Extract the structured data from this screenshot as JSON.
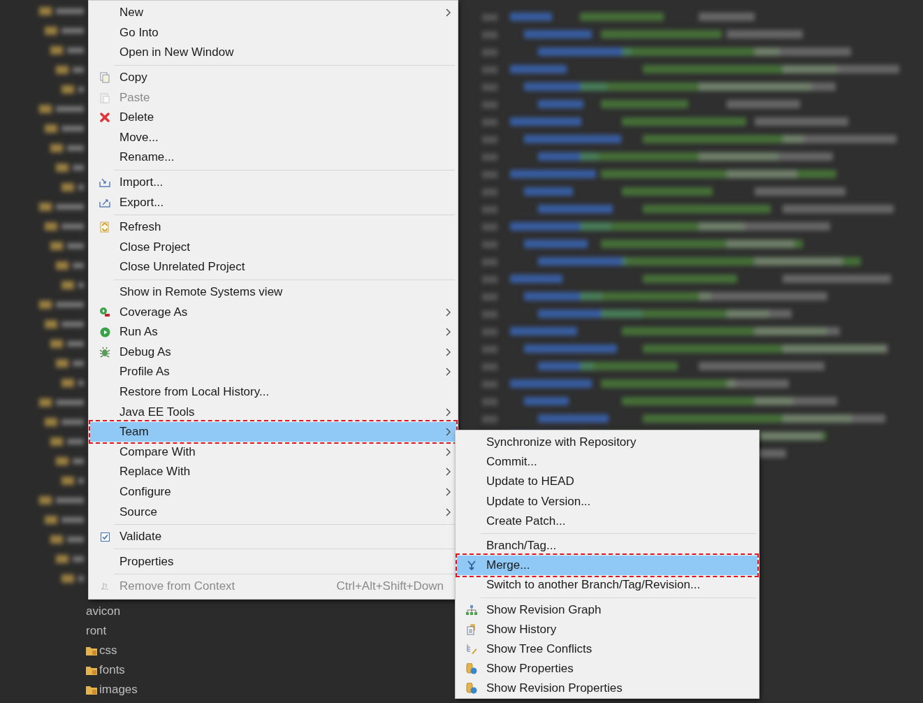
{
  "tree": [
    {
      "label": "avicon",
      "kind": "plain"
    },
    {
      "label": "ront",
      "kind": "plain"
    },
    {
      "label": "css",
      "kind": "folder"
    },
    {
      "label": "fonts",
      "kind": "folder"
    },
    {
      "label": "images",
      "kind": "folder"
    }
  ],
  "context_menu": {
    "groups": [
      [
        {
          "label": "New",
          "submenu": true
        },
        {
          "label": "Go Into"
        },
        {
          "label": "Open in New Window"
        }
      ],
      [
        {
          "label": "Copy",
          "kind": "copy"
        },
        {
          "label": "Paste",
          "kind": "paste",
          "disabled": true
        },
        {
          "label": "Delete",
          "kind": "delete"
        },
        {
          "label": "Move..."
        },
        {
          "label": "Rename..."
        }
      ],
      [
        {
          "label": "Import...",
          "kind": "import"
        },
        {
          "label": "Export...",
          "kind": "export"
        }
      ],
      [
        {
          "label": "Refresh",
          "kind": "refresh"
        },
        {
          "label": "Close Project"
        },
        {
          "label": "Close Unrelated Project"
        }
      ],
      [
        {
          "label": "Show in Remote Systems view"
        },
        {
          "label": "Coverage As",
          "kind": "coverage",
          "submenu": true
        },
        {
          "label": "Run As",
          "kind": "run",
          "submenu": true
        },
        {
          "label": "Debug As",
          "kind": "debug",
          "submenu": true
        },
        {
          "label": "Profile As",
          "submenu": true
        },
        {
          "label": "Restore from Local History..."
        },
        {
          "label": "Java EE Tools",
          "submenu": true
        },
        {
          "label": "Team",
          "submenu": true,
          "selected": true,
          "marked": true
        },
        {
          "label": "Compare With",
          "submenu": true
        },
        {
          "label": "Replace With",
          "submenu": true
        },
        {
          "label": "Configure",
          "submenu": true
        },
        {
          "label": "Source",
          "submenu": true
        }
      ],
      [
        {
          "label": "Validate",
          "kind": "checkbox",
          "checked": true
        }
      ],
      [
        {
          "label": "Properties"
        }
      ],
      [
        {
          "label": "Remove from Context",
          "kind": "remove",
          "disabled": true,
          "shortcut": "Ctrl+Alt+Shift+Down"
        }
      ]
    ]
  },
  "team_submenu": {
    "groups": [
      [
        {
          "label": "Synchronize with Repository"
        },
        {
          "label": "Commit..."
        },
        {
          "label": "Update to HEAD"
        },
        {
          "label": "Update to Version..."
        },
        {
          "label": "Create Patch..."
        }
      ],
      [
        {
          "label": "Branch/Tag..."
        },
        {
          "label": "Merge...",
          "kind": "merge",
          "selected": true,
          "marked": true
        },
        {
          "label": "Switch to another Branch/Tag/Revision..."
        }
      ],
      [
        {
          "label": "Show Revision Graph",
          "kind": "graph"
        },
        {
          "label": "Show History",
          "kind": "history"
        },
        {
          "label": "Show Tree Conflicts",
          "kind": "tree"
        },
        {
          "label": "Show Properties",
          "kind": "properties"
        },
        {
          "label": "Show Revision Properties",
          "kind": "properties"
        }
      ]
    ]
  }
}
